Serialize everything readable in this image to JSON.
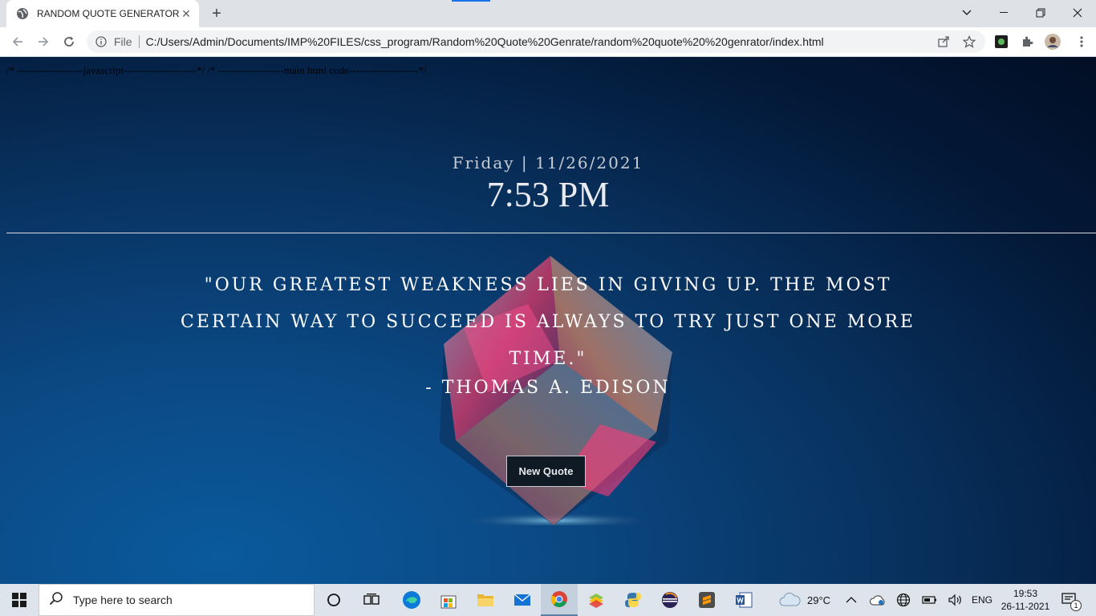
{
  "browser": {
    "tab_title": "RANDOM QUOTE GENERATOR",
    "omnibox_scheme": "File",
    "url": "C:/Users/Admin/Documents/IMP%20FILES/css_program/Random%20Quote%20Genrate/random%20quote%20%20genrator/index.html"
  },
  "page": {
    "comment_text": "/* -------------------javascript---------------------*/ /* -------------------main html code--------------------*/",
    "date": "Friday | 11/26/2021",
    "time": "7:53 PM",
    "quote": "\"Our greatest weakness lies in giving up. The most certain way to succeed is always to try just one more time.\"",
    "author": "- THOMAS A. EDISON",
    "button_label": "New Quote"
  },
  "taskbar": {
    "search_placeholder": "Type here to search",
    "weather_temp": "29°C",
    "language": "ENG",
    "clock_time": "19:53",
    "clock_date": "26-11-2021",
    "notification_count": "1"
  },
  "colors": {
    "page_bg_dark": "#020e25",
    "page_bg_light": "#0a5a9c",
    "text_light": "#ffffff",
    "accent_blue": "#1a73e8"
  }
}
